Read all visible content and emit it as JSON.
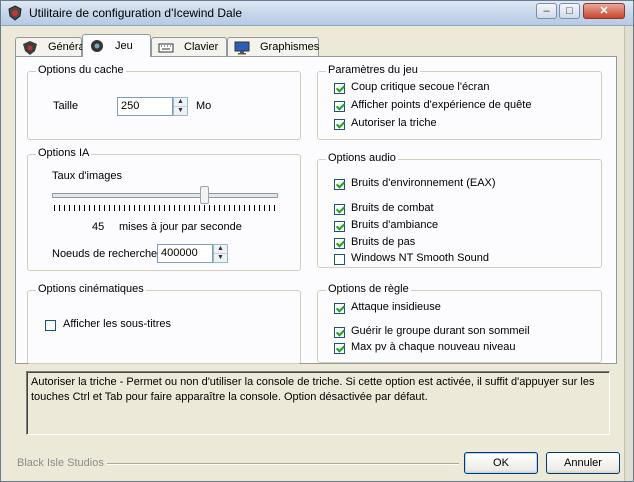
{
  "window": {
    "title": "Utilitaire de configuration d'Icewind Dale",
    "controls": [
      "minimize",
      "maximize",
      "close"
    ]
  },
  "tabs": [
    {
      "label": "Général",
      "icon": "shield-icon",
      "active": false
    },
    {
      "label": "Jeu",
      "icon": "gear-icon",
      "active": true
    },
    {
      "label": "Clavier",
      "icon": "keyboard-icon",
      "active": false
    },
    {
      "label": "Graphismes",
      "icon": "monitor-icon",
      "active": false
    }
  ],
  "cache": {
    "title": "Options du cache",
    "size_label": "Taille",
    "size_value": "250",
    "unit": "Mo"
  },
  "ai": {
    "title": "Options IA",
    "frame_rate_label": "Taux d'images",
    "slider_fraction": 0.68,
    "frame_rate_value": "45",
    "frame_rate_unit": "mises à jour par seconde",
    "pathfinding_label": "Noeuds de recherche",
    "pathfinding_value": "400000"
  },
  "cinematics": {
    "title": "Options cinématiques",
    "subtitles_label": "Afficher les sous-titres",
    "subtitles_checked": false
  },
  "game": {
    "title": "Paramètres du jeu",
    "items": [
      {
        "label": "Coup critique secoue l'écran",
        "checked": true
      },
      {
        "label": "Afficher points d'expérience de quête",
        "checked": true
      },
      {
        "label": "Autoriser la triche",
        "checked": true
      }
    ]
  },
  "audio": {
    "title": "Options audio",
    "items": [
      {
        "label": "Bruits d'environnement (EAX)",
        "checked": true
      },
      {
        "label": "Bruits de combat",
        "checked": true
      },
      {
        "label": "Bruits d'ambiance",
        "checked": true
      },
      {
        "label": "Bruits de pas",
        "checked": true
      },
      {
        "label": "Windows NT Smooth Sound",
        "checked": false
      }
    ]
  },
  "rules": {
    "title": "Options de règle",
    "items": [
      {
        "label": "Attaque insidieuse",
        "checked": true
      },
      {
        "label": "Guérir le groupe durant son sommeil",
        "checked": true
      },
      {
        "label": "Max pv à chaque nouveau niveau",
        "checked": true
      }
    ]
  },
  "description": "Autoriser la triche - Permet ou non d'utiliser la console de triche. Si cette option est activée, il suffit d'appuyer sur les touches Ctrl et Tab pour faire apparaître la console. Option désactivée par défaut.",
  "footer": {
    "company": "Black Isle Studios",
    "ok_label": "OK",
    "cancel_label": "Annuler"
  }
}
